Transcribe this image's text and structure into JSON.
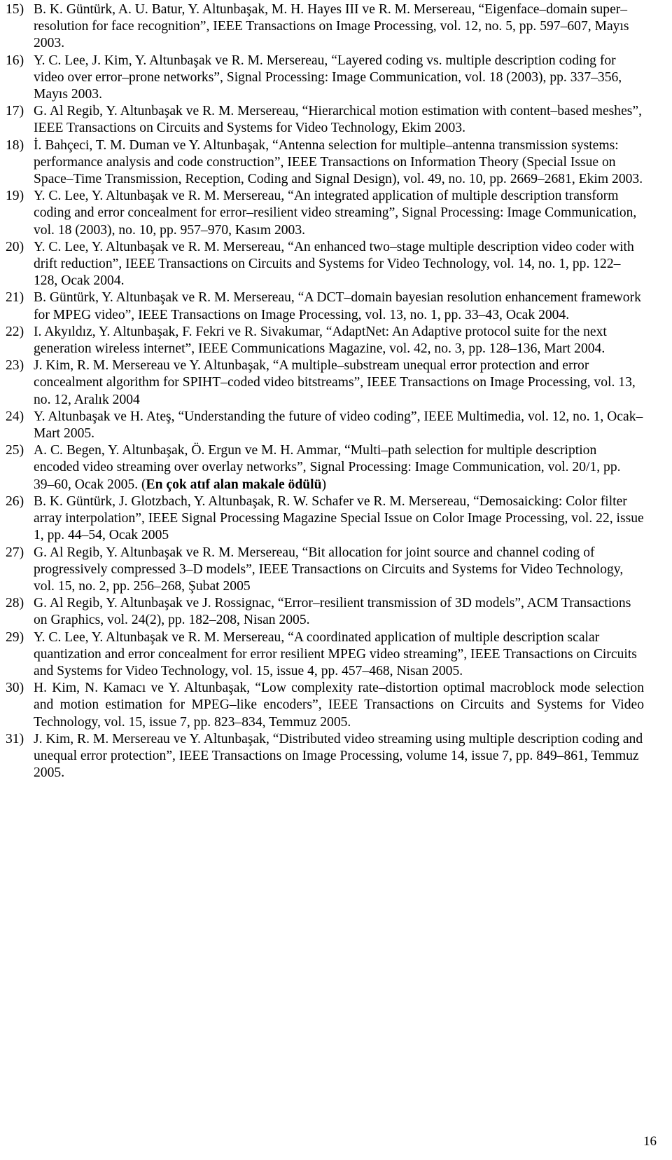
{
  "references": [
    {
      "num": "15)",
      "text": "B. K. Güntürk, A. U. Batur, Y. Altunbaşak, M. H. Hayes III ve R. M. Mersereau, “Eigenface–domain super–resolution for face recognition”, IEEE Transactions on Image Processing, vol. 12, no. 5, pp. 597–607, Mayıs 2003."
    },
    {
      "num": "16)",
      "text": "Y. C. Lee, J. Kim, Y. Altunbaşak ve R. M. Mersereau, “Layered coding vs. multiple description coding for video over error–prone networks”, Signal Processing: Image Communication, vol. 18 (2003), pp. 337–356, Mayıs 2003."
    },
    {
      "num": "17)",
      "text": "G. Al Regib, Y. Altunbaşak ve R. M. Mersereau, “Hierarchical motion estimation with content–based meshes”, IEEE Transactions on Circuits and Systems for Video Technology, Ekim 2003."
    },
    {
      "num": "18)",
      "text": "İ. Bahçeci, T. M. Duman ve Y. Altunbaşak, “Antenna selection for multiple–antenna transmission systems: performance analysis and code construction”, IEEE Transactions on Information Theory (Special Issue on Space–Time Transmission, Reception, Coding and Signal Design), vol. 49, no. 10, pp. 2669–2681, Ekim 2003."
    },
    {
      "num": "19)",
      "text": "Y. C. Lee, Y. Altunbaşak ve R. M. Mersereau, “An integrated application of multiple description transform coding and error concealment for error–resilient video streaming”, Signal Processing: Image Communication, vol. 18 (2003), no. 10, pp. 957–970, Kasım 2003."
    },
    {
      "num": "20)",
      "text": "Y. C. Lee, Y. Altunbaşak ve R. M. Mersereau, “An enhanced two–stage multiple description video coder with drift reduction”, IEEE Transactions on Circuits and Systems for Video Technology, vol. 14, no. 1, pp. 122–128, Ocak 2004."
    },
    {
      "num": "21)",
      "text": "B. Güntürk, Y. Altunbaşak ve R. M. Mersereau, “A DCT–domain bayesian resolution enhancement framework for MPEG video”, IEEE Transactions on Image Processing, vol. 13, no. 1, pp. 33–43, Ocak 2004."
    },
    {
      "num": "22)",
      "text": "I. Akyıldız, Y. Altunbaşak, F. Fekri ve R. Sivakumar, “AdaptNet: An Adaptive protocol suite for the next generation wireless internet”, IEEE Communications Magazine, vol. 42, no. 3, pp. 128–136, Mart 2004."
    },
    {
      "num": "23)",
      "text": "J. Kim, R. M. Mersereau ve Y. Altunbaşak, “A multiple–substream unequal error protection and error concealment algorithm for SPIHT–coded video bitstreams”, IEEE Transactions on Image Processing, vol. 13, no. 12, Aralık 2004"
    },
    {
      "num": "24)",
      "text": "Y. Altunbaşak ve H. Ateş, “Understanding the future of video coding”, IEEE Multimedia, vol. 12, no. 1, Ocak–Mart 2005."
    },
    {
      "num": "25)",
      "text": "A. C. Begen, Y. Altunbaşak, Ö. Ergun ve M. H. Ammar, “Multi–path selection for multiple description encoded video streaming over overlay networks”, Signal Processing: Image Communication, vol. 20/1, pp. 39–60, Ocak 2005. (",
      "bold": "En çok atıf alan makale ödülü",
      "after": ")"
    },
    {
      "num": "26)",
      "text": "B. K. Güntürk, J. Glotzbach, Y. Altunbaşak, R. W. Schafer ve R. M. Mersereau, “Demosaicking: Color filter array interpolation”, IEEE Signal Processing Magazine Special Issue on Color Image Processing, vol. 22, issue 1, pp. 44–54, Ocak 2005"
    },
    {
      "num": "27)",
      "text": "G. Al Regib, Y. Altunbaşak ve R. M. Mersereau, “Bit allocation for joint source and channel coding of progressively compressed 3–D models”, IEEE Transactions on Circuits and Systems for Video Technology, vol. 15, no. 2, pp. 256–268, Şubat 2005"
    },
    {
      "num": "28)",
      "text": "G. Al Regib, Y. Altunbaşak ve J. Rossignac, “Error–resilient transmission of 3D models”, ACM Transactions on Graphics, vol. 24(2), pp. 182–208, Nisan 2005."
    },
    {
      "num": "29)",
      "text": "Y. C. Lee, Y. Altunbaşak ve R. M. Mersereau, “A coordinated application of multiple description scalar quantization and error concealment for error resilient MPEG video streaming”, IEEE Transactions on Circuits and Systems for Video Technology, vol. 15, issue 4, pp.  457–468, Nisan 2005."
    },
    {
      "num": "30)",
      "text": "H. Kim, N. Kamacı ve Y. Altunbaşak, “Low complexity rate–distortion optimal macroblock mode selection and motion estimation for MPEG–like encoders”, IEEE Transactions on Circuits and Systems for Video Technology, vol. 15, issue 7, pp. 823–834, Temmuz 2005.",
      "justify": true
    },
    {
      "num": "31)",
      "text": "J. Kim, R. M. Mersereau ve Y. Altunbaşak, “Distributed video streaming using multiple description coding and unequal error protection”, IEEE Transactions on Image Processing, volume 14, issue 7, pp. 849–861, Temmuz 2005."
    }
  ],
  "page_number": "16"
}
